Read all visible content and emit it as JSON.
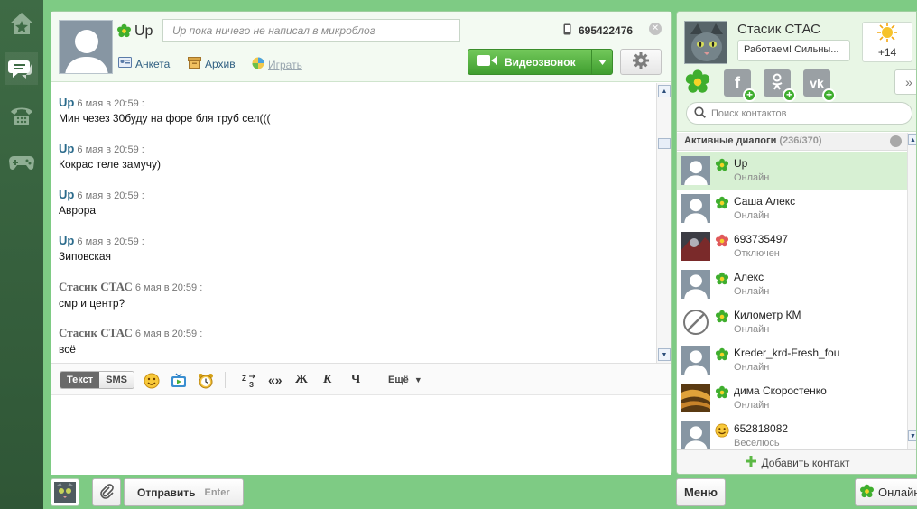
{
  "chat": {
    "contact_name": "Up",
    "status_placeholder": "Up пока ничего не написал в микроблог",
    "phone": "695422476",
    "links": {
      "profile": "Анкета",
      "archive": "Архив",
      "play": "Играть"
    },
    "video_call_label": "Видеозвонок",
    "messages": [
      {
        "author": "Up",
        "time": "6 мая в 20:59 :",
        "text": "Мин чезез 30буду на форе бля труб сел((("
      },
      {
        "author": "Up",
        "time": "6 мая в 20:59 :",
        "text": "Кокрас теле замучу)"
      },
      {
        "author": "Up",
        "time": "6 мая в 20:59 :",
        "text": "Аврора"
      },
      {
        "author": "Up",
        "time": "6 мая в 20:59 :",
        "text": "Зиповская"
      },
      {
        "author": "Стасик СТАС",
        "time": "6 мая в 20:59 :",
        "text": "смр и центр?"
      },
      {
        "author": "Стасик СТАС",
        "time": "6 мая в 20:59 :",
        "text": "всё"
      }
    ],
    "toolbar": {
      "mode_text": "Текст",
      "mode_sms": "SMS",
      "format_bold": "Ж",
      "format_italic": "К",
      "format_underline": "Ч",
      "quotes": "«»",
      "more": "Ещё"
    },
    "send_label": "Отправить",
    "send_key": "Enter"
  },
  "side": {
    "my_name": "Стасик СТАС",
    "my_status": "Работаем! Сильны...",
    "weather_temp": "+14",
    "search_placeholder": "Поиск контактов",
    "active_title": "Активные диалоги",
    "active_count": "(236/370)",
    "contacts": [
      {
        "name": "Up",
        "status": "Онлайн",
        "state": "online"
      },
      {
        "name": "Саша Алекс",
        "status": "Онлайн",
        "state": "online"
      },
      {
        "name": "693735497",
        "status": "Отключен",
        "state": "offline"
      },
      {
        "name": "Алекс",
        "status": "Онлайн",
        "state": "online"
      },
      {
        "name": "Километр КМ",
        "status": "Онлайн",
        "state": "online"
      },
      {
        "name": "Kreder_krd-Fresh_fou",
        "status": "Онлайн",
        "state": "online"
      },
      {
        "name": "дима Скоростенко",
        "status": "Онлайн",
        "state": "online"
      },
      {
        "name": "652818082",
        "status": "Веселюсь",
        "state": "happy"
      }
    ],
    "add_contact": "Добавить контакт",
    "menu_label": "Меню",
    "online_label": "Онлайн"
  },
  "icons": {
    "rail": [
      "home-icon",
      "chat-icon",
      "phone-icon",
      "gamepad-icon"
    ],
    "status_online_color": "#3fae2e",
    "status_offline_color": "#d9534f"
  }
}
